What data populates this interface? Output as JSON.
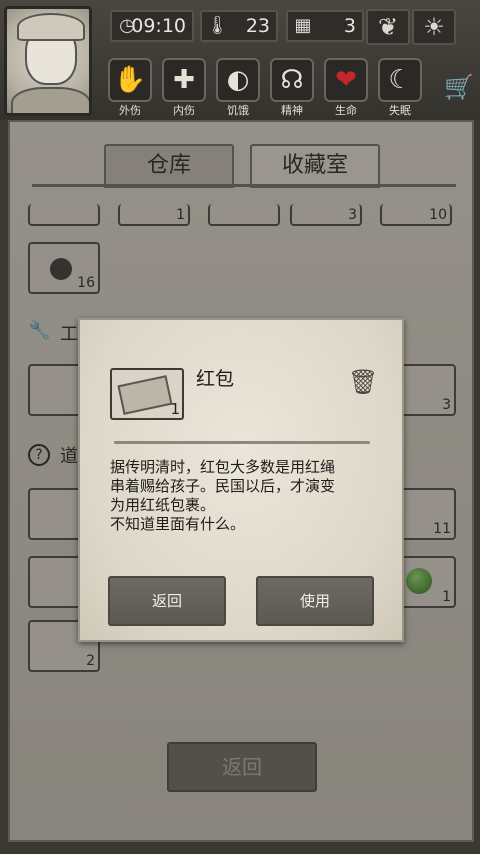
{
  "topbar": {
    "time": "09:10",
    "temperature": "23",
    "day": "3",
    "icons": [
      "clock-icon",
      "thermometer-icon",
      "calendar-icon",
      "leaf-icon",
      "sun-icon"
    ],
    "status": [
      {
        "label": "外伤",
        "icon": "hand-icon"
      },
      {
        "label": "内伤",
        "icon": "cross-icon"
      },
      {
        "label": "饥饿",
        "icon": "stomach-icon"
      },
      {
        "label": "精神",
        "icon": "brain-icon"
      },
      {
        "label": "生命",
        "icon": "heart-icon"
      },
      {
        "label": "失眠",
        "icon": "moon-icon"
      }
    ]
  },
  "tabs": [
    {
      "label": "仓库"
    },
    {
      "label": "收藏室"
    }
  ],
  "inventory": {
    "row1_counts": [
      "",
      "1",
      "",
      "3",
      "10"
    ],
    "row2_count": "16",
    "section_tools_label": "工",
    "tools_count_right": "3",
    "section_props_label": "道",
    "props_counts": [
      "",
      "11",
      "",
      "1",
      "2"
    ],
    "back_label": "返回"
  },
  "dialog": {
    "item_name": "红包",
    "item_count": "1",
    "description": "据传明清时，红包大多数是用红绳\n串着赐给孩子。民国以后，才演变\n为用红纸包裹。\n不知道里面有什么。",
    "back_button": "返回",
    "use_button": "使用"
  }
}
